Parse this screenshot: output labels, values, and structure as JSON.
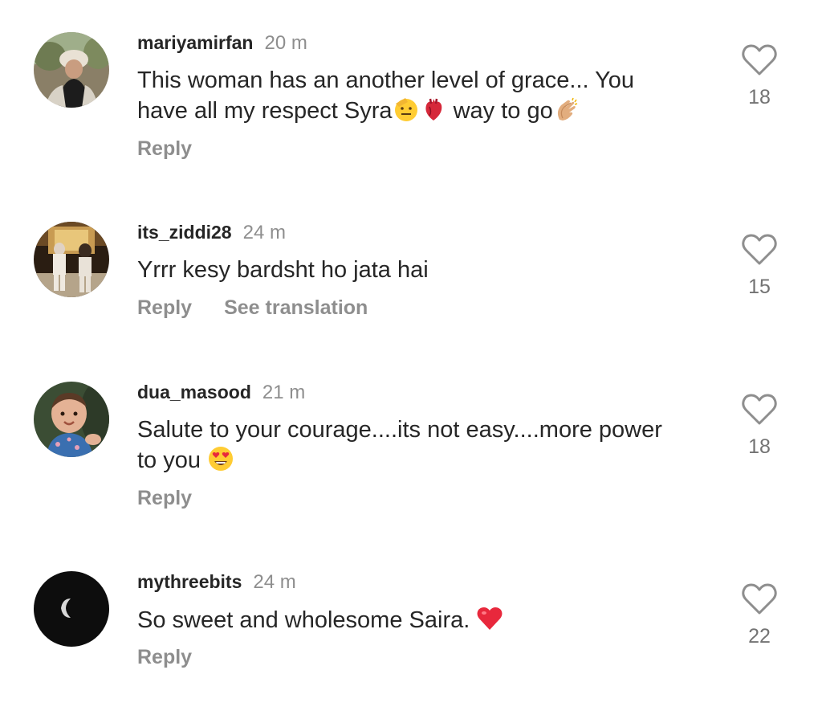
{
  "comments": [
    {
      "username": "mariyamirfan",
      "time": "20 m",
      "text_lines": [
        "This woman has an another level of grace... You",
        "have all my respect Syra",
        " way to go"
      ],
      "emoji": [
        "saluting-face",
        "anatomical-heart",
        "clapping-hands"
      ],
      "reply": "Reply",
      "likes": "18"
    },
    {
      "username": "its_ziddi28",
      "time": "24 m",
      "text": "Yrrr kesy bardsht ho jata hai",
      "reply": "Reply",
      "translate": "See translation",
      "likes": "15"
    },
    {
      "username": "dua_masood",
      "time": "21 m",
      "text_lines": [
        "Salute to your courage....its not easy....more power",
        "to you "
      ],
      "emoji": [
        "heart-eyes"
      ],
      "reply": "Reply",
      "likes": "18"
    },
    {
      "username": "mythreebits",
      "time": "24 m",
      "text": "So sweet and wholesome Saira. ",
      "emoji": [
        "red-heart"
      ],
      "reply": "Reply",
      "likes": "22"
    }
  ]
}
